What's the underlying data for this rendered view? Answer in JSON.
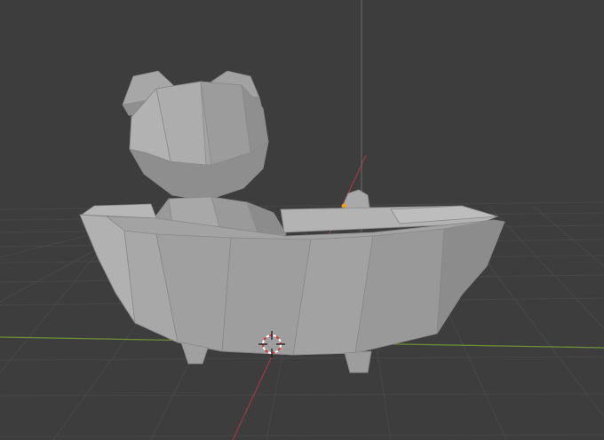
{
  "viewport": {
    "background_color": "#3d3d3d",
    "grid_line_color": "#4a4a4a",
    "x_axis_color": "#6e8f35",
    "y_axis_color": "#9c3a4a",
    "mesh_base_color": "#a9a9a9",
    "mesh_edge_color": "#7a7a7a",
    "duck_eye_color": "#f2a000",
    "objects": [
      {
        "name": "bathtub",
        "icon": "bathtub-mesh"
      },
      {
        "name": "bear",
        "icon": "bear-mesh"
      },
      {
        "name": "duck",
        "icon": "duck-mesh"
      }
    ],
    "cursor_icon": "3d-cursor-icon"
  }
}
